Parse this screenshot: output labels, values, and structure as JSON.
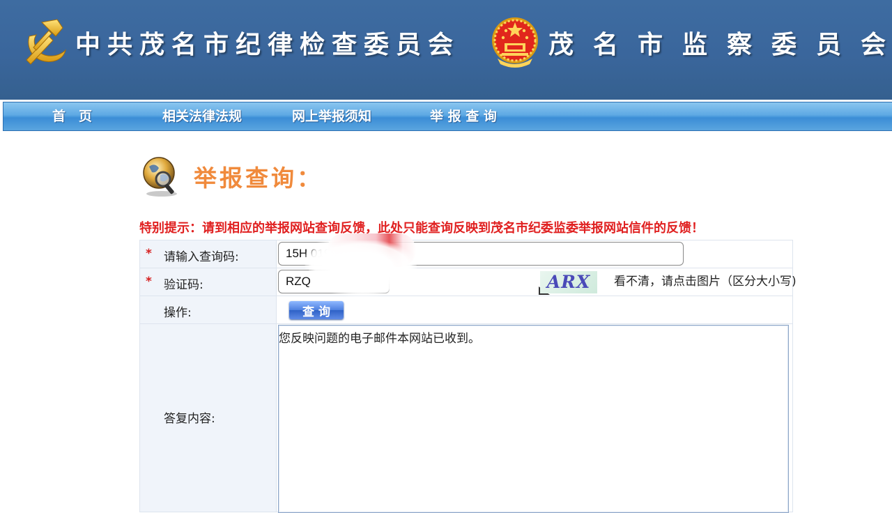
{
  "header": {
    "title_left": "中共茂名市纪律检查委员会",
    "title_right": "茂名市监察委员会",
    "party_emblem_icon": "party-emblem",
    "state_emblem_icon": "national-emblem"
  },
  "nav": {
    "items": [
      {
        "label": "首　页"
      },
      {
        "label": "相关法律法规"
      },
      {
        "label": "网上举报须知"
      },
      {
        "label": "举 报 查 询"
      }
    ]
  },
  "page": {
    "title": "举报查询：",
    "title_icon": "globe-magnifier-icon",
    "notice": "特别提示：请到相应的举报网站查询反馈，此处只能查询反映到茂名市纪委监委举报网站信件的反馈！"
  },
  "form": {
    "query_code": {
      "required_mark": "*",
      "label": "请输入查询码:",
      "value": "15H                         019B"
    },
    "captcha": {
      "required_mark": "*",
      "label": "验证码:",
      "value": "RZQ",
      "image_text": "ARX",
      "hint": "看不清，请点击图片（区分大小写)"
    },
    "operation": {
      "label": "操作:",
      "button_label": "查询"
    },
    "reply": {
      "label": "答复内容:",
      "content": "您反映问题的电子邮件本网站已收到。"
    }
  },
  "colors": {
    "banner": "#3a669c",
    "nav": "#4a9ae0",
    "title_orange": "#f08a3c",
    "notice_red": "#e02020"
  }
}
